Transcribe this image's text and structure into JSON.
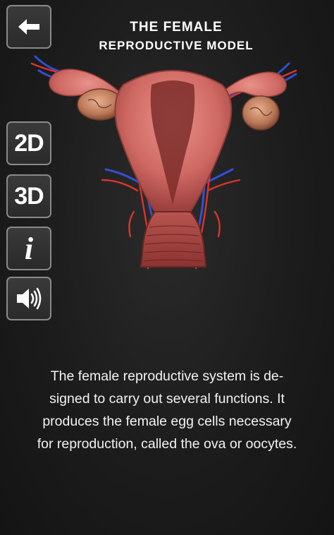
{
  "header": {
    "title_line1": "THE FEMALE",
    "title_line2": "REPRODUCTIVE MODEL"
  },
  "toolbar": {
    "back_icon": "arrow-left-icon",
    "view_2d_label": "2D",
    "view_3d_label": "3D",
    "info_label": "i",
    "sound_icon": "speaker-volume-icon"
  },
  "model": {
    "subject": "uterus-ovaries-fallopian-tubes-with-vessels",
    "colors": {
      "tissue": "#d9736e",
      "tissue_dark": "#8e3a3a",
      "artery": "#d8322c",
      "vein": "#2f4fd8"
    }
  },
  "description": {
    "line1": "The female reproductive system is de-",
    "line2": "signed to carry out several functions. It",
    "line3": "produces the female egg cells necessary",
    "line4": "for reproduction, called the ova or oocytes."
  }
}
